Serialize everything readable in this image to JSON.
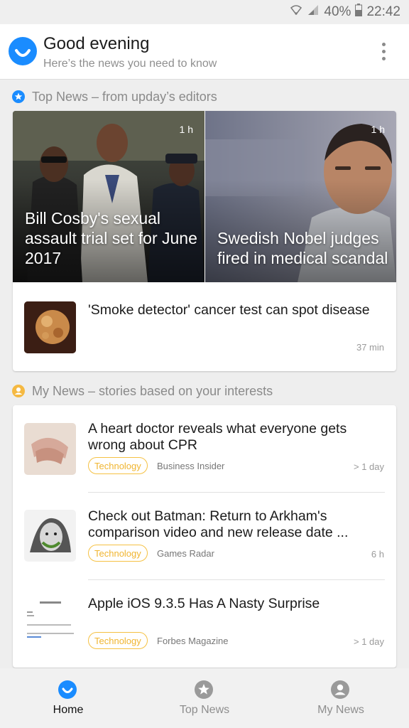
{
  "status": {
    "battery": "40%",
    "time": "22:42"
  },
  "header": {
    "greeting": "Good evening",
    "subtitle": "Here’s the news you need to know"
  },
  "top_news": {
    "section_title": "Top News – from upday’s editors",
    "tiles": [
      {
        "time": "1 h",
        "title": "Bill Cosby's sexual assault trial set for June 2017"
      },
      {
        "time": "1 h",
        "title": "Swedish Nobel judges fired in medical scandal"
      }
    ],
    "row": {
      "title": "'Smoke detector' cancer test can spot disease",
      "time": "37 min"
    }
  },
  "my_news": {
    "section_title": "My News – stories based on your interests",
    "items": [
      {
        "title": "A heart doctor reveals what everyone gets wrong about CPR",
        "tag": "Technology",
        "source": "Business Insider",
        "time": "> 1 day"
      },
      {
        "title": "Check out Batman: Return to Arkham's comparison video and new release date ...",
        "tag": "Technology",
        "source": "Games Radar",
        "time": "6 h"
      },
      {
        "title": "Apple iOS 9.3.5 Has A Nasty Surprise",
        "tag": "Technology",
        "source": "Forbes Magazine",
        "time": "> 1 day"
      }
    ]
  },
  "bottom_nav": [
    {
      "label": "Home",
      "icon": "home-smile-icon",
      "active": true
    },
    {
      "label": "Top News",
      "icon": "star-icon",
      "active": false
    },
    {
      "label": "My News",
      "icon": "person-icon",
      "active": false
    }
  ],
  "colors": {
    "accent": "#1a8cff",
    "tag": "#f5c143",
    "my_news_icon": "#f5b942"
  }
}
